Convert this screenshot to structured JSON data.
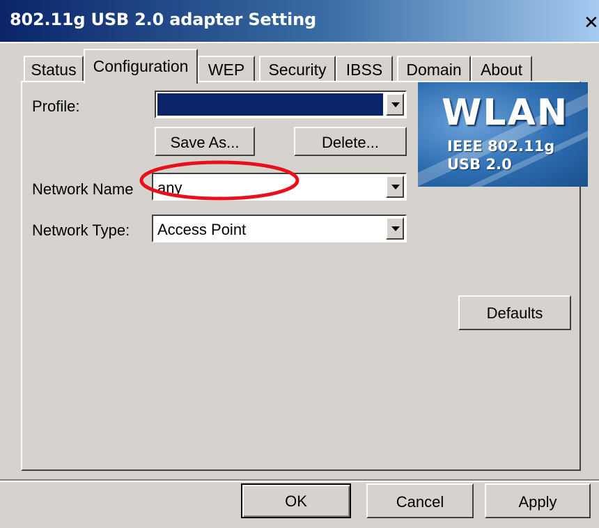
{
  "window": {
    "title": "802.11g USB 2.0 adapter Setting",
    "close_glyph": "✕"
  },
  "tabs": [
    {
      "label": "Status",
      "active": false
    },
    {
      "label": "Configuration",
      "active": true
    },
    {
      "label": "WEP",
      "active": false
    },
    {
      "label": "Security",
      "active": false
    },
    {
      "label": "IBSS",
      "active": false
    },
    {
      "label": "Domain",
      "active": false
    },
    {
      "label": "About",
      "active": false
    }
  ],
  "config": {
    "profile_label": "Profile:",
    "profile_value": "",
    "save_as_label": "Save As...",
    "delete_label": "Delete...",
    "network_name_label": "Network Name",
    "network_name_value": "any",
    "network_type_label": "Network Type:",
    "network_type_value": "Access Point",
    "defaults_label": "Defaults"
  },
  "logo": {
    "title": "WLAN",
    "line1": "IEEE 802.11g",
    "line2": "USB 2.0"
  },
  "footer": {
    "ok_label": "OK",
    "cancel_label": "Cancel",
    "apply_label": "Apply"
  },
  "annotation": {
    "highlight_color": "#e8101a"
  },
  "colors": {
    "dialog_bg": "#d6d3ce",
    "title_start": "#0a246a",
    "selection": "#0a246a"
  }
}
